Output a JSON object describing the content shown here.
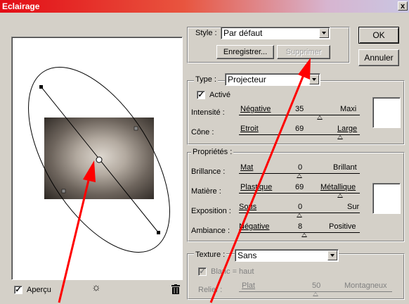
{
  "window": {
    "title": "Eclairage",
    "close": "x"
  },
  "style": {
    "label": "Style :",
    "value": "Par défaut",
    "save_button": "Enregistrer...",
    "delete_button": "Supprimer"
  },
  "buttons": {
    "ok": "OK",
    "cancel": "Annuler"
  },
  "light": {
    "type_label": "Type :",
    "type_value": "Projecteur",
    "active_label": "Activé",
    "active_checked": true,
    "intensity": {
      "label": "Intensité :",
      "min": "Négative",
      "value": "35",
      "max": "Maxi",
      "fraction": 0.67
    },
    "cone": {
      "label": "Cône :",
      "min": "Etroit",
      "value": "69",
      "max": "Large",
      "fraction": 0.84
    },
    "color": "#ffffff"
  },
  "properties": {
    "title": "Propriétés :",
    "gloss": {
      "label": "Brillance :",
      "min": "Mat",
      "value": "0",
      "max": "Brillant",
      "fraction": 0.5
    },
    "material": {
      "label": "Matière :",
      "min": "Plastique",
      "value": "69",
      "max": "Métallique",
      "fraction": 0.84
    },
    "exposure": {
      "label": "Exposition :",
      "min": "Sous",
      "value": "0",
      "max": "Sur",
      "fraction": 0.5
    },
    "ambience": {
      "label": "Ambiance :",
      "min": "Négative",
      "value": "8",
      "max": "Positive",
      "fraction": 0.54
    },
    "color": "#ffffff"
  },
  "texture": {
    "label": "Texture :",
    "value": "Sans",
    "white_high_label": "Blanc = haut",
    "white_high_checked": true,
    "relief": {
      "label": "Relief :",
      "min": "Plat",
      "value": "50",
      "max": "Montagneux",
      "fraction": 0.5
    }
  },
  "preview": {
    "label": "Aperçu",
    "checked": true,
    "light_icon": "lightbulb-icon",
    "trash_icon": "trash-icon"
  },
  "annotation_color": "#ff0000"
}
